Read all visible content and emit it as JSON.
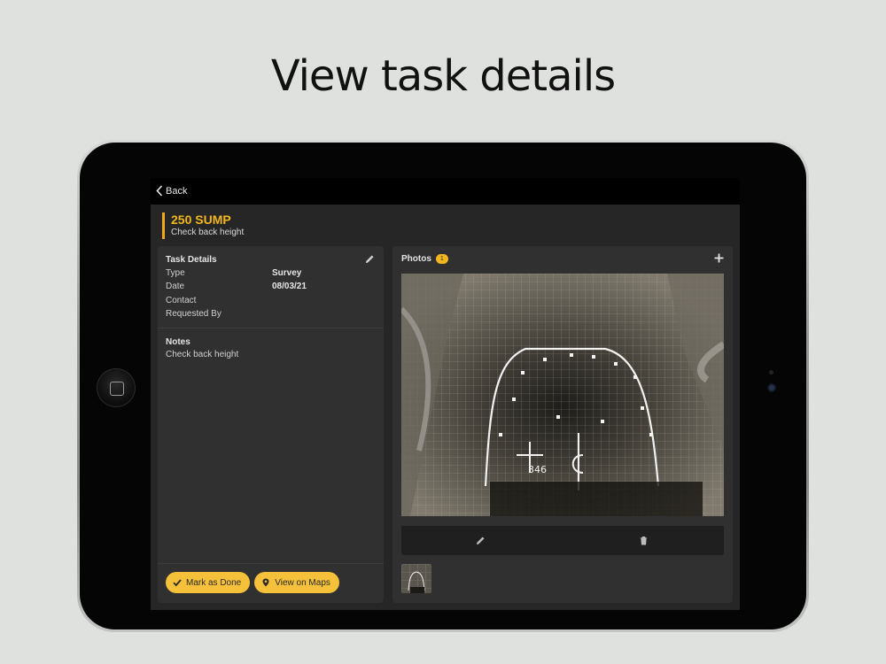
{
  "headline": "View task details",
  "nav": {
    "back_label": "Back"
  },
  "task": {
    "title": "250 SUMP",
    "subtitle": "Check back height"
  },
  "details": {
    "heading": "Task Details",
    "rows": [
      {
        "label": "Type",
        "value": "Survey"
      },
      {
        "label": "Date",
        "value": "08/03/21"
      },
      {
        "label": "Contact",
        "value": ""
      },
      {
        "label": "Requested By",
        "value": ""
      }
    ]
  },
  "notes": {
    "heading": "Notes",
    "body": "Check back height"
  },
  "actions": {
    "mark_done": "Mark as Done",
    "view_maps": "View on Maps"
  },
  "photos": {
    "heading": "Photos",
    "count": "1"
  },
  "colors": {
    "accent": "#f2b61f",
    "panel": "#303030",
    "background": "#262626"
  },
  "icons": [
    "chevron-left-icon",
    "pencil-icon",
    "plus-icon",
    "check-icon",
    "map-pin-icon",
    "trash-icon"
  ]
}
